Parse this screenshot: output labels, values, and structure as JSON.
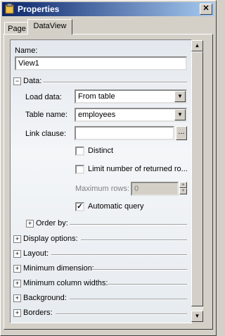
{
  "window": {
    "title": "Properties",
    "close_label": "✕"
  },
  "tabs": [
    {
      "label": "Page"
    },
    {
      "label": "DataView"
    }
  ],
  "name_field": {
    "label": "Name:",
    "value": "View1"
  },
  "data_section": {
    "label": "Data:",
    "load_data": {
      "label": "Load data:",
      "value": "From table"
    },
    "table_name": {
      "label": "Table name:",
      "value": "employees"
    },
    "link_clause": {
      "label": "Link clause:",
      "value": "",
      "browse_label": "..."
    },
    "distinct": {
      "label": "Distinct",
      "checked": false
    },
    "limit_rows": {
      "label": "Limit number of returned ro...",
      "checked": false
    },
    "max_rows": {
      "label": "Maximum rows:",
      "value": "0"
    },
    "automatic_query": {
      "label": "Automatic query",
      "checked": true
    },
    "order_by": {
      "label": "Order by:"
    }
  },
  "sections": [
    {
      "label": "Display options:"
    },
    {
      "label": "Layout:"
    },
    {
      "label": "Minimum dimension:"
    },
    {
      "label": "Minimum column widths:"
    },
    {
      "label": "Background:"
    },
    {
      "label": "Borders:"
    }
  ],
  "glyphs": {
    "plus": "+",
    "minus": "−",
    "check": "✓",
    "down": "▼",
    "up": "▲"
  }
}
